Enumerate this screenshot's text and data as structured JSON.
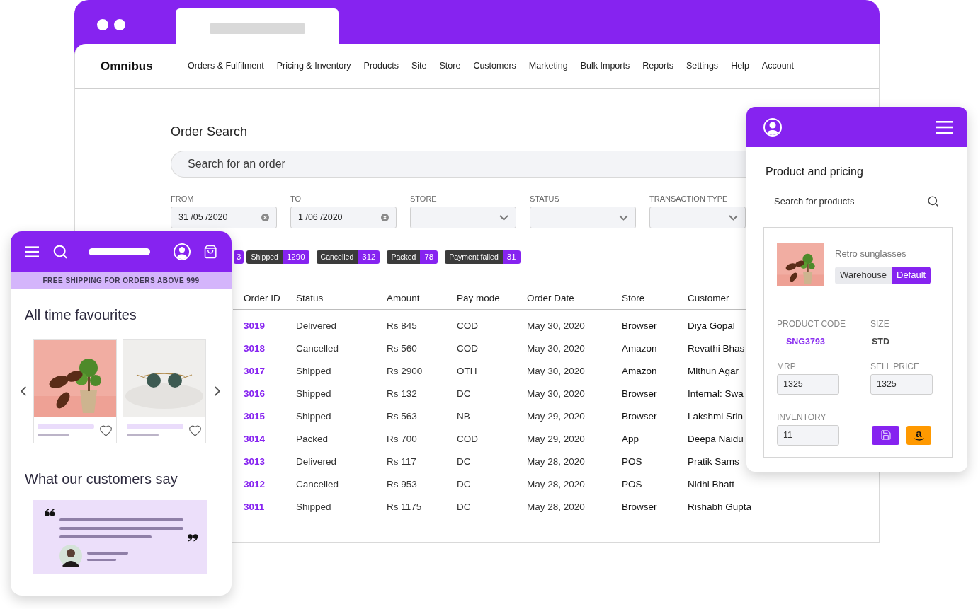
{
  "browser": {
    "brand": "Omnibus",
    "nav": [
      "Orders & Fulfilment",
      "Pricing & Inventory",
      "Products",
      "Site",
      "Store",
      "Customers",
      "Marketing",
      "Bulk Imports",
      "Reports",
      "Settings",
      "Help",
      "Account"
    ]
  },
  "order_search": {
    "title": "Order Search",
    "search": {
      "placeholder": "Search for an order"
    },
    "filters": [
      {
        "kind": "date",
        "label": "FROM",
        "value": "31 /05 /2020"
      },
      {
        "kind": "date",
        "label": "TO",
        "value": "1 /06 /2020"
      },
      {
        "kind": "select",
        "label": "STORE"
      },
      {
        "kind": "select",
        "label": "STATUS"
      },
      {
        "kind": "select",
        "label": "TRANSACTION TYPE"
      }
    ],
    "status_badges": [
      {
        "count": "3"
      },
      {
        "label": "Shipped",
        "count": "1290"
      },
      {
        "label": "Cancelled",
        "count": "312"
      },
      {
        "label": "Packed",
        "count": "78"
      },
      {
        "label": "Payment failed",
        "count": "31"
      }
    ],
    "table": {
      "columns": [
        "Order ID",
        "Status",
        "Amount",
        "Pay mode",
        "Order Date",
        "Store",
        "Customer"
      ],
      "rows": [
        {
          "order_id": "3019",
          "status": "Delivered",
          "amount": "Rs 845",
          "pay_mode": "COD",
          "order_date": "May 30, 2020",
          "store": "Browser",
          "customer": "Diya Gopal"
        },
        {
          "order_id": "3018",
          "status": "Cancelled",
          "amount": "Rs 560",
          "pay_mode": "COD",
          "order_date": "May 30, 2020",
          "store": "Amazon",
          "customer": "Revathi Bhas"
        },
        {
          "order_id": "3017",
          "status": "Shipped",
          "amount": "Rs 2900",
          "pay_mode": "OTH",
          "order_date": "May 30, 2020",
          "store": "Amazon",
          "customer": "Mithun Agar"
        },
        {
          "order_id": "3016",
          "status": "Shipped",
          "amount": "Rs 132",
          "pay_mode": "DC",
          "order_date": "May 30, 2020",
          "store": "Browser",
          "customer": "Internal: Swa"
        },
        {
          "order_id": "3015",
          "status": "Shipped",
          "amount": "Rs 563",
          "pay_mode": "NB",
          "order_date": "May 29, 2020",
          "store": "Browser",
          "customer": "Lakshmi Srin"
        },
        {
          "order_id": "3014",
          "status": "Packed",
          "amount": "Rs 700",
          "pay_mode": "COD",
          "order_date": "May 29, 2020",
          "store": "App",
          "customer": "Deepa Naidu"
        },
        {
          "order_id": "3013",
          "status": "Delivered",
          "amount": "Rs 117",
          "pay_mode": "DC",
          "order_date": "May 28, 2020",
          "store": "POS",
          "customer": "Pratik Sams"
        },
        {
          "order_id": "3012",
          "status": "Cancelled",
          "amount": "Rs 953",
          "pay_mode": "DC",
          "order_date": "May 28, 2020",
          "store": "POS",
          "customer": "Nidhi Bhatt"
        },
        {
          "order_id": "3011",
          "status": "Shipped",
          "amount": "Rs 1175",
          "pay_mode": "DC",
          "order_date": "May 28, 2020",
          "store": "Browser",
          "customer": "Rishabh Gupta"
        }
      ]
    }
  },
  "mobile": {
    "banner": "FREE SHIPPING FOR ORDERS ABOVE 999",
    "favourites_title": "All time favourites",
    "testimonials_title": "What our customers say"
  },
  "product_panel": {
    "title": "Product and pricing",
    "search": {
      "placeholder": "Search for products"
    },
    "product": {
      "name": "Retro sunglasses",
      "segments": [
        {
          "label": "Warehouse",
          "selected": false
        },
        {
          "label": "Default",
          "selected": true
        }
      ],
      "code_label": "PRODUCT CODE",
      "code": "SNG3793",
      "size_label": "SIZE",
      "size": "STD",
      "mrp_label": "MRP",
      "mrp": "1325",
      "sell_label": "SELL PRICE",
      "sell_price": "1325",
      "inventory_label": "INVENTORY",
      "inventory": "11"
    },
    "marketplace_button": "a"
  }
}
